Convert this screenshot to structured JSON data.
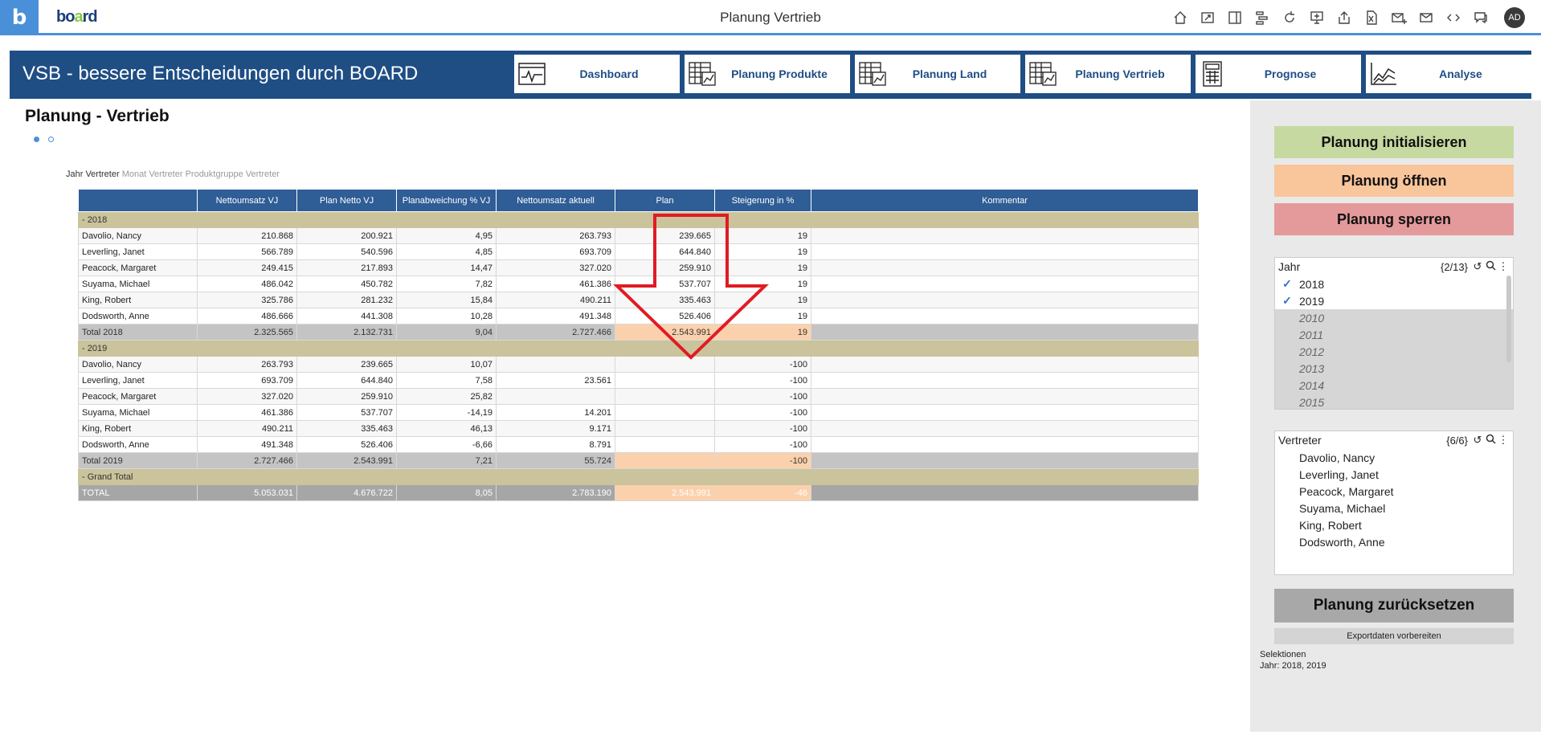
{
  "app": {
    "logo_text": "board",
    "page_title": "Planung Vertrieb",
    "user_initials": "AD"
  },
  "toolbar": [
    "home-icon",
    "fullscreen-icon",
    "panel-icon",
    "org-icon",
    "refresh-icon",
    "presentation-icon",
    "upload-icon",
    "excel-icon",
    "mail-add-icon",
    "mail-icon",
    "code-icon",
    "chat-icon"
  ],
  "banner": {
    "title": "VSB - bessere Entscheidungen durch BOARD",
    "nav": [
      "Dashboard",
      "Planung Produkte",
      "Planung Land",
      "Planung Vertrieb",
      "Prognose",
      "Analyse"
    ]
  },
  "main": {
    "title": "Planung  -  Vertrieb",
    "crumbs": {
      "active": "Jahr Vertreter",
      "rest": "Monat Vertreter  Produktgruppe Vertreter"
    }
  },
  "table": {
    "headers": [
      "",
      "Nettoumsatz VJ",
      "Plan Netto VJ",
      "Planabweichung % VJ",
      "Nettoumsatz aktuell",
      "Plan",
      "Steigerung in %",
      "Kommentar"
    ],
    "rows": [
      {
        "type": "group",
        "cells": [
          "-  2018"
        ]
      },
      {
        "type": "data",
        "cells": [
          "Davolio, Nancy",
          "210.868",
          "200.921",
          "4,95",
          "263.793",
          "239.665",
          "19",
          ""
        ]
      },
      {
        "type": "data",
        "cells": [
          "Leverling, Janet",
          "566.789",
          "540.596",
          "4,85",
          "693.709",
          "644.840",
          "19",
          ""
        ]
      },
      {
        "type": "data",
        "cells": [
          "Peacock, Margaret",
          "249.415",
          "217.893",
          "14,47",
          "327.020",
          "259.910",
          "19",
          ""
        ]
      },
      {
        "type": "data",
        "cells": [
          "Suyama, Michael",
          "486.042",
          "450.782",
          "7,82",
          "461.386",
          "537.707",
          "19",
          ""
        ]
      },
      {
        "type": "data",
        "cells": [
          "King, Robert",
          "325.786",
          "281.232",
          "15,84",
          "490.211",
          "335.463",
          "19",
          ""
        ]
      },
      {
        "type": "data",
        "cells": [
          "Dodsworth, Anne",
          "486.666",
          "441.308",
          "10,28",
          "491.348",
          "526.406",
          "19",
          ""
        ]
      },
      {
        "type": "total",
        "cells": [
          "Total 2018",
          "2.325.565",
          "2.132.731",
          "9,04",
          "2.727.466",
          "2.543.991",
          "19",
          ""
        ]
      },
      {
        "type": "group",
        "cells": [
          "-  2019"
        ]
      },
      {
        "type": "data",
        "cells": [
          "Davolio, Nancy",
          "263.793",
          "239.665",
          "10,07",
          "",
          "",
          "-100",
          ""
        ]
      },
      {
        "type": "data",
        "cells": [
          "Leverling, Janet",
          "693.709",
          "644.840",
          "7,58",
          "23.561",
          "",
          "-100",
          ""
        ]
      },
      {
        "type": "data",
        "cells": [
          "Peacock, Margaret",
          "327.020",
          "259.910",
          "25,82",
          "",
          "",
          "-100",
          ""
        ]
      },
      {
        "type": "data",
        "cells": [
          "Suyama, Michael",
          "461.386",
          "537.707",
          "-14,19",
          "14.201",
          "",
          "-100",
          ""
        ]
      },
      {
        "type": "data",
        "cells": [
          "King, Robert",
          "490.211",
          "335.463",
          "46,13",
          "9.171",
          "",
          "-100",
          ""
        ]
      },
      {
        "type": "data",
        "cells": [
          "Dodsworth, Anne",
          "491.348",
          "526.406",
          "-6,66",
          "8.791",
          "",
          "-100",
          ""
        ]
      },
      {
        "type": "total",
        "cells": [
          "Total 2019",
          "2.727.466",
          "2.543.991",
          "7,21",
          "55.724",
          "",
          "-100",
          ""
        ]
      },
      {
        "type": "group",
        "cells": [
          "-  Grand Total"
        ]
      },
      {
        "type": "gtotal",
        "cells": [
          "TOTAL",
          "5.053.031",
          "4.676.722",
          "8,05",
          "2.783.190",
          "2.543.991",
          "-46",
          ""
        ]
      }
    ]
  },
  "actions": {
    "init": "Planung initialisieren",
    "open": "Planung öffnen",
    "lock": "Planung sperren",
    "reset": "Planung zurücksetzen",
    "export": "Exportdaten vorbereiten",
    "colors": {
      "init": "#c6d9a0",
      "open": "#f9c59b",
      "lock": "#e49a9a"
    }
  },
  "year_selector": {
    "title": "Jahr",
    "count": "{2/13}",
    "options": [
      {
        "label": "2018",
        "checked": true,
        "disabled": false
      },
      {
        "label": "2019",
        "checked": true,
        "disabled": false
      },
      {
        "label": "2010",
        "checked": false,
        "disabled": true
      },
      {
        "label": "2011",
        "checked": false,
        "disabled": true
      },
      {
        "label": "2012",
        "checked": false,
        "disabled": true
      },
      {
        "label": "2013",
        "checked": false,
        "disabled": true
      },
      {
        "label": "2014",
        "checked": false,
        "disabled": true
      },
      {
        "label": "2015",
        "checked": false,
        "disabled": true
      }
    ]
  },
  "rep_selector": {
    "title": "Vertreter",
    "count": "{6/6}",
    "options": [
      "Davolio, Nancy",
      "Leverling, Janet",
      "Peacock, Margaret",
      "Suyama, Michael",
      "King, Robert",
      "Dodsworth, Anne"
    ]
  },
  "selection_info": {
    "label": "Selektionen",
    "value": "Jahr: 2018, 2019"
  }
}
